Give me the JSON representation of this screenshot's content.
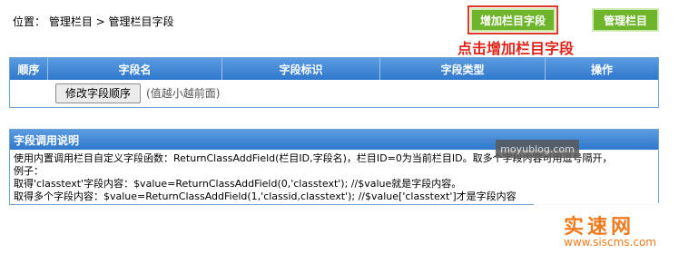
{
  "breadcrumb": {
    "text": "位置： 管理栏目 > 管理栏目字段"
  },
  "buttons": {
    "add_field": "增加栏目字段",
    "manage_columns": "管理栏目"
  },
  "annotation": "点击增加栏目字段",
  "field_table": {
    "headers": [
      "顺序",
      "字段名",
      "字段标识",
      "字段类型",
      "操作"
    ],
    "reorder_button": "修改字段顺序",
    "reorder_hint": "(值越小越前面)"
  },
  "usage": {
    "title": "字段调用说明",
    "lines": [
      "使用内置调用栏目自定义字段函数：ReturnClassAddField(栏目ID,字段名)，栏目ID=0为当前栏目ID。取多个字段内容可用逗号隔开，",
      "例子：",
      "取得'classtext'字段内容：$value=ReturnClassAddField(0,'classtext'); //$value就是字段内容。",
      "取得多个字段内容：$value=ReturnClassAddField(1,'classid,classtext'); //$value['classtext']才是字段内容"
    ]
  },
  "watermarks": {
    "small": "moyublog.com",
    "brand": "实速网",
    "brand_url": "www.siscms.com"
  },
  "colors": {
    "accent_green": "#6fb52b",
    "header_blue": "#3c85d6",
    "annotation_red": "#e0241b",
    "watermark_orange": "#f07b1e"
  }
}
